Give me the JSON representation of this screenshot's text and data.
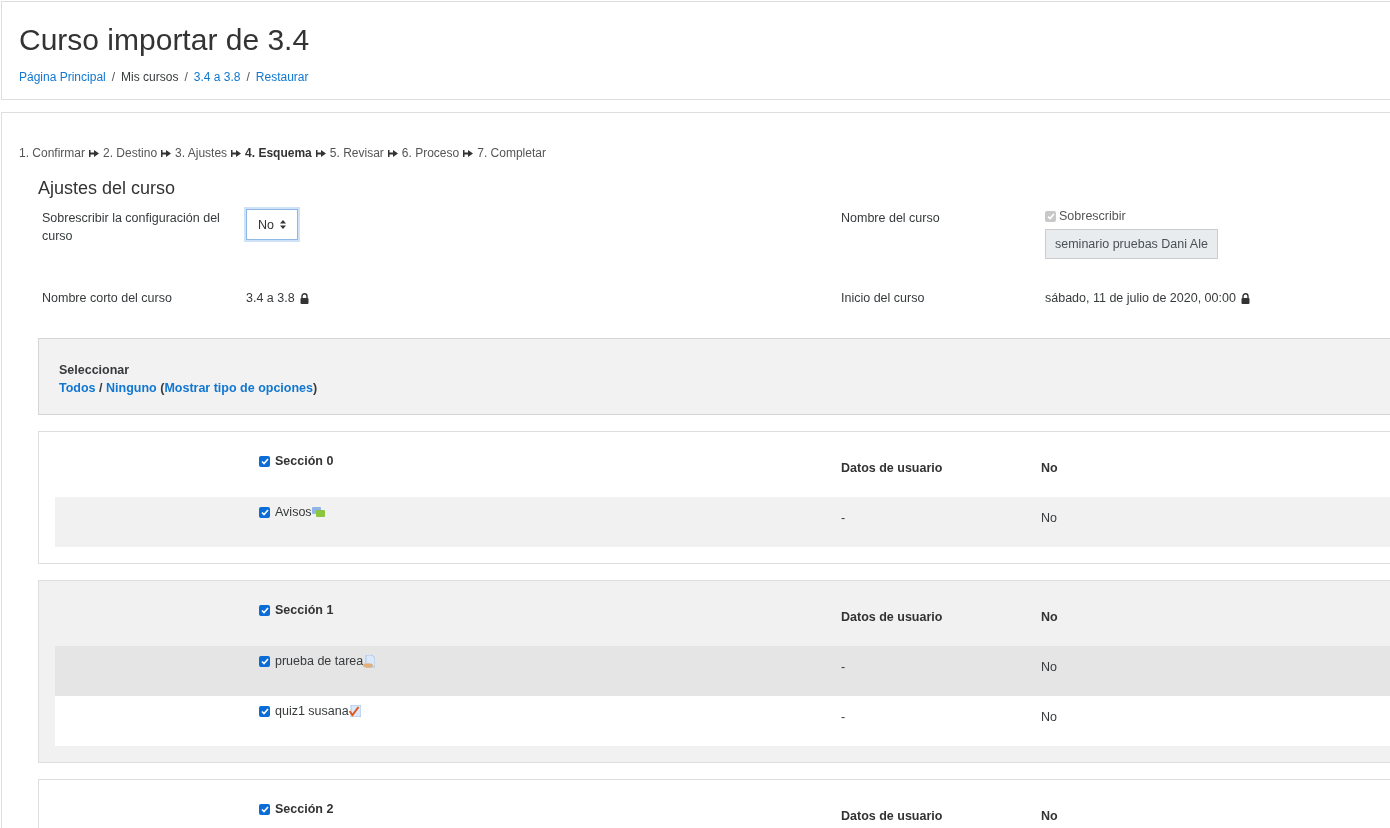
{
  "header": {
    "title": "Curso importar de 3.4",
    "breadcrumb": [
      {
        "label": "Página Principal",
        "link": true,
        "separator": "/"
      },
      {
        "label": "Mis cursos",
        "link": false,
        "separator": "/"
      },
      {
        "label": "3.4 a 3.8",
        "link": true,
        "separator": "/"
      },
      {
        "label": "Restaurar",
        "link": true
      }
    ]
  },
  "steps": [
    {
      "label": "1. Confirmar",
      "selected": false
    },
    {
      "label": "2. Destino",
      "selected": false
    },
    {
      "label": "3. Ajustes",
      "selected": false
    },
    {
      "label": "4. Esquema",
      "selected": true
    },
    {
      "label": "5. Revisar",
      "selected": false
    },
    {
      "label": "6. Proceso",
      "selected": false
    },
    {
      "label": "7. Completar",
      "selected": false
    }
  ],
  "course_settings": {
    "heading": "Ajustes del curso",
    "overwrite_label": "Sobrescribir la configuración del curso",
    "overwrite_value": "No",
    "course_name_label": "Nombre del curso",
    "course_name_overwrite": {
      "label": "Sobrescribir",
      "checked": true,
      "disabled": true
    },
    "course_name_value": "seminario pruebas Dani Ale",
    "short_name_label": "Nombre corto del curso",
    "short_name_value": "3.4 a 3.8",
    "start_label": "Inicio del curso",
    "start_value": "sábado, 11 de julio de 2020, 00:00"
  },
  "select_box": {
    "title": "Seleccionar",
    "all": "Todos",
    "separator": "/",
    "none": "Ninguno",
    "open_paren": "(",
    "show_types": "Mostrar tipo de opciones",
    "close_paren": ")"
  },
  "sections": [
    {
      "name": "Sección 0",
      "checked": true,
      "user_data_label": "Datos de usuario",
      "user_data_value": "No",
      "activities": [
        {
          "name": "Avisos",
          "kind": "forum",
          "checked": true,
          "user_data": "-",
          "value": "No"
        }
      ]
    },
    {
      "name": "Sección 1",
      "checked": true,
      "user_data_label": "Datos de usuario",
      "user_data_value": "No",
      "activities": [
        {
          "name": "prueba de tarea",
          "kind": "assignment",
          "checked": true,
          "user_data": "-",
          "value": "No"
        },
        {
          "name": "quiz1 susana",
          "kind": "quiz",
          "checked": true,
          "user_data": "-",
          "value": "No"
        }
      ]
    },
    {
      "name": "Sección 2",
      "checked": true,
      "user_data_label": "Datos de usuario",
      "user_data_value": "No"
    }
  ]
}
